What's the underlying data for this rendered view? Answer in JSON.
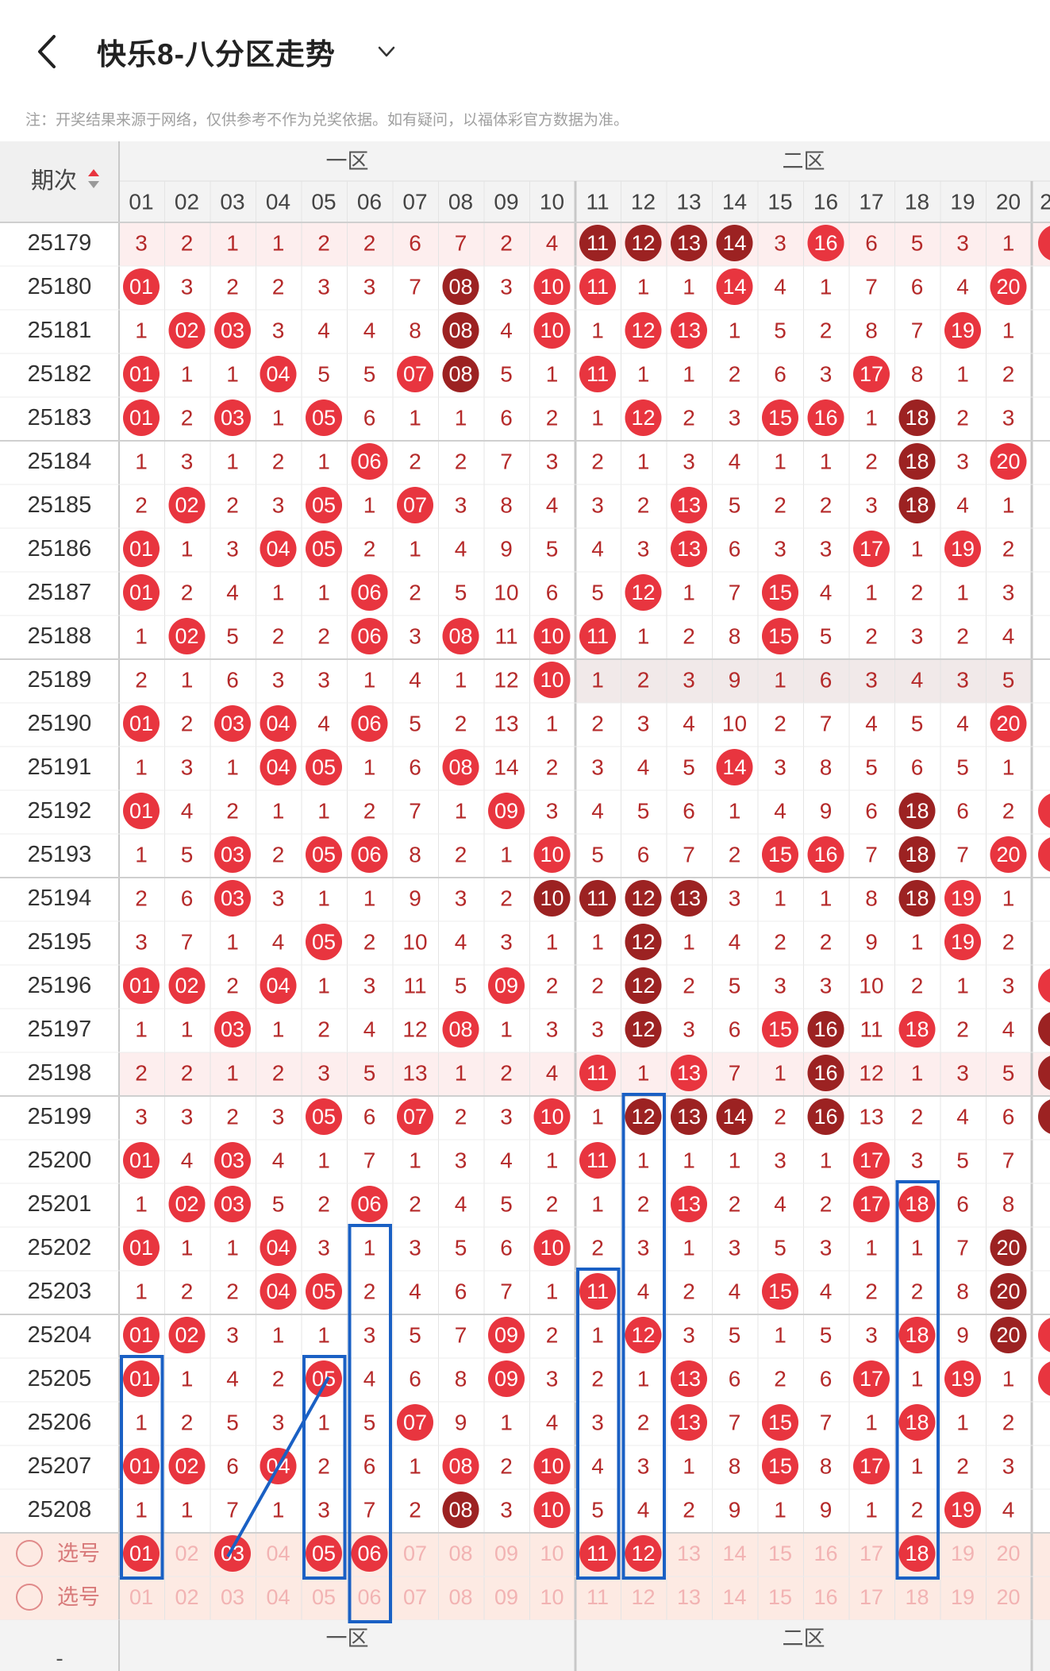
{
  "header": {
    "title": "快乐8-八分区走势",
    "back_icon": "chevron-left-icon",
    "dropdown_icon": "chevron-down-icon"
  },
  "note": "注：开奖结果来源于网络，仅供参考不作为兑奖依据。如有疑问，以福体彩官方数据为准。",
  "table": {
    "period_header": "期次",
    "sort_icon": "sort-arrows-icon",
    "zones": [
      "一区",
      "二区"
    ],
    "columns": [
      "01",
      "02",
      "03",
      "04",
      "05",
      "06",
      "07",
      "08",
      "09",
      "10",
      "11",
      "12",
      "13",
      "14",
      "15",
      "16",
      "17",
      "18",
      "19",
      "20"
    ],
    "rows": [
      {
        "period": "25179",
        "cells": [
          "3",
          "2",
          "1",
          "1",
          "2",
          "2",
          "6",
          "7",
          "2",
          "4",
          "11",
          "12",
          "13",
          "14",
          "3",
          "16",
          "6",
          "5",
          "3",
          "1"
        ],
        "dark": [
          "11",
          "12",
          "13",
          "14"
        ],
        "bg": "pink"
      },
      {
        "period": "25180",
        "cells": [
          "01",
          "3",
          "2",
          "2",
          "3",
          "3",
          "7",
          "08",
          "3",
          "10",
          "11",
          "1",
          "1",
          "14",
          "4",
          "1",
          "7",
          "6",
          "4",
          "20"
        ],
        "dark": [
          "08"
        ]
      },
      {
        "period": "25181",
        "cells": [
          "1",
          "02",
          "03",
          "3",
          "4",
          "4",
          "8",
          "08",
          "4",
          "10",
          "1",
          "12",
          "13",
          "1",
          "5",
          "2",
          "8",
          "7",
          "19",
          "1"
        ],
        "dark": [
          "08"
        ]
      },
      {
        "period": "25182",
        "cells": [
          "01",
          "1",
          "1",
          "04",
          "5",
          "5",
          "07",
          "08",
          "5",
          "1",
          "11",
          "1",
          "1",
          "2",
          "6",
          "3",
          "17",
          "8",
          "1",
          "2"
        ],
        "dark": [
          "08"
        ]
      },
      {
        "period": "25183",
        "cells": [
          "01",
          "2",
          "03",
          "1",
          "05",
          "6",
          "1",
          "1",
          "6",
          "2",
          "1",
          "12",
          "2",
          "3",
          "15",
          "16",
          "1",
          "18",
          "2",
          "3"
        ],
        "dark": [
          "18"
        ]
      },
      {
        "period": "25184",
        "cells": [
          "1",
          "3",
          "1",
          "2",
          "1",
          "06",
          "2",
          "2",
          "7",
          "3",
          "2",
          "1",
          "3",
          "4",
          "1",
          "1",
          "2",
          "18",
          "3",
          "20"
        ],
        "dark": [
          "18"
        ]
      },
      {
        "period": "25185",
        "cells": [
          "2",
          "02",
          "2",
          "3",
          "05",
          "1",
          "07",
          "3",
          "8",
          "4",
          "3",
          "2",
          "13",
          "5",
          "2",
          "2",
          "3",
          "18",
          "4",
          "1"
        ],
        "dark": [
          "18"
        ]
      },
      {
        "period": "25186",
        "cells": [
          "01",
          "1",
          "3",
          "04",
          "05",
          "2",
          "1",
          "4",
          "9",
          "5",
          "4",
          "3",
          "13",
          "6",
          "3",
          "3",
          "17",
          "1",
          "19",
          "2"
        ],
        "dark": []
      },
      {
        "period": "25187",
        "cells": [
          "01",
          "2",
          "4",
          "1",
          "1",
          "06",
          "2",
          "5",
          "10",
          "6",
          "5",
          "12",
          "1",
          "7",
          "15",
          "4",
          "1",
          "2",
          "1",
          "3"
        ],
        "dark": []
      },
      {
        "period": "25188",
        "cells": [
          "1",
          "02",
          "5",
          "2",
          "2",
          "06",
          "3",
          "08",
          "11",
          "10",
          "11",
          "1",
          "2",
          "8",
          "15",
          "5",
          "2",
          "3",
          "2",
          "4"
        ],
        "dark": []
      },
      {
        "period": "25189",
        "cells": [
          "2",
          "1",
          "6",
          "3",
          "3",
          "1",
          "4",
          "1",
          "12",
          "10",
          "1",
          "2",
          "3",
          "9",
          "1",
          "6",
          "3",
          "4",
          "3",
          "5"
        ],
        "dark": [],
        "bg": "zone2-gray"
      },
      {
        "period": "25190",
        "cells": [
          "01",
          "2",
          "03",
          "04",
          "4",
          "06",
          "5",
          "2",
          "13",
          "1",
          "2",
          "3",
          "4",
          "10",
          "2",
          "7",
          "4",
          "5",
          "4",
          "20"
        ],
        "dark": []
      },
      {
        "period": "25191",
        "cells": [
          "1",
          "3",
          "1",
          "04",
          "05",
          "1",
          "6",
          "08",
          "14",
          "2",
          "3",
          "4",
          "5",
          "14",
          "3",
          "8",
          "5",
          "6",
          "5",
          "1"
        ],
        "dark": []
      },
      {
        "period": "25192",
        "cells": [
          "01",
          "4",
          "2",
          "1",
          "1",
          "2",
          "7",
          "1",
          "09",
          "3",
          "4",
          "5",
          "6",
          "1",
          "4",
          "9",
          "6",
          "18",
          "6",
          "2"
        ],
        "dark": [
          "18"
        ]
      },
      {
        "period": "25193",
        "cells": [
          "1",
          "5",
          "03",
          "2",
          "05",
          "06",
          "8",
          "2",
          "1",
          "10",
          "5",
          "6",
          "7",
          "2",
          "15",
          "16",
          "7",
          "18",
          "7",
          "20"
        ],
        "dark": [
          "18"
        ]
      },
      {
        "period": "25194",
        "cells": [
          "2",
          "6",
          "03",
          "3",
          "1",
          "1",
          "9",
          "3",
          "2",
          "10",
          "11",
          "12",
          "13",
          "3",
          "1",
          "1",
          "8",
          "18",
          "19",
          "1"
        ],
        "dark": [
          "10",
          "11",
          "12",
          "13",
          "18"
        ]
      },
      {
        "period": "25195",
        "cells": [
          "3",
          "7",
          "1",
          "4",
          "05",
          "2",
          "10",
          "4",
          "3",
          "1",
          "1",
          "12",
          "1",
          "4",
          "2",
          "2",
          "9",
          "1",
          "19",
          "2"
        ],
        "dark": [
          "12"
        ]
      },
      {
        "period": "25196",
        "cells": [
          "01",
          "02",
          "2",
          "04",
          "1",
          "3",
          "11",
          "5",
          "09",
          "2",
          "2",
          "12",
          "2",
          "5",
          "3",
          "3",
          "10",
          "2",
          "1",
          "3"
        ],
        "dark": [
          "12"
        ]
      },
      {
        "period": "25197",
        "cells": [
          "1",
          "1",
          "03",
          "1",
          "2",
          "4",
          "12",
          "08",
          "1",
          "3",
          "3",
          "12",
          "3",
          "6",
          "15",
          "16",
          "11",
          "18",
          "2",
          "4"
        ],
        "dark": [
          "12",
          "16"
        ]
      },
      {
        "period": "25198",
        "cells": [
          "2",
          "2",
          "1",
          "2",
          "3",
          "5",
          "13",
          "1",
          "2",
          "4",
          "11",
          "1",
          "13",
          "7",
          "1",
          "16",
          "12",
          "1",
          "3",
          "5"
        ],
        "dark": [
          "16"
        ],
        "bg": "pink"
      },
      {
        "period": "25199",
        "cells": [
          "3",
          "3",
          "2",
          "3",
          "05",
          "6",
          "07",
          "2",
          "3",
          "10",
          "1",
          "12",
          "13",
          "14",
          "2",
          "16",
          "13",
          "2",
          "4",
          "6"
        ],
        "dark": [
          "12",
          "13",
          "14",
          "16"
        ]
      },
      {
        "period": "25200",
        "cells": [
          "01",
          "4",
          "03",
          "4",
          "1",
          "7",
          "1",
          "3",
          "4",
          "1",
          "11",
          "1",
          "1",
          "1",
          "3",
          "1",
          "17",
          "3",
          "5",
          "7"
        ],
        "dark": []
      },
      {
        "period": "25201",
        "cells": [
          "1",
          "02",
          "03",
          "5",
          "2",
          "06",
          "2",
          "4",
          "5",
          "2",
          "1",
          "2",
          "13",
          "2",
          "4",
          "2",
          "17",
          "18",
          "6",
          "8"
        ],
        "dark": []
      },
      {
        "period": "25202",
        "cells": [
          "01",
          "1",
          "1",
          "04",
          "3",
          "1",
          "3",
          "5",
          "6",
          "10",
          "2",
          "3",
          "1",
          "3",
          "5",
          "3",
          "1",
          "1",
          "7",
          "20"
        ],
        "dark": [
          "20"
        ]
      },
      {
        "period": "25203",
        "cells": [
          "1",
          "2",
          "2",
          "04",
          "05",
          "2",
          "4",
          "6",
          "7",
          "1",
          "11",
          "4",
          "2",
          "4",
          "15",
          "4",
          "2",
          "2",
          "8",
          "20"
        ],
        "dark": [
          "20"
        ]
      },
      {
        "period": "25204",
        "cells": [
          "01",
          "02",
          "3",
          "1",
          "1",
          "3",
          "5",
          "7",
          "09",
          "2",
          "1",
          "12",
          "3",
          "5",
          "1",
          "5",
          "3",
          "18",
          "9",
          "20"
        ],
        "dark": [
          "20"
        ]
      },
      {
        "period": "25205",
        "cells": [
          "01",
          "1",
          "4",
          "2",
          "05",
          "4",
          "6",
          "8",
          "09",
          "3",
          "2",
          "1",
          "13",
          "6",
          "2",
          "6",
          "17",
          "1",
          "19",
          "1"
        ],
        "dark": []
      },
      {
        "period": "25206",
        "cells": [
          "1",
          "2",
          "5",
          "3",
          "1",
          "5",
          "07",
          "9",
          "1",
          "4",
          "3",
          "2",
          "13",
          "7",
          "15",
          "7",
          "1",
          "18",
          "1",
          "2"
        ],
        "dark": []
      },
      {
        "period": "25207",
        "cells": [
          "01",
          "02",
          "6",
          "04",
          "2",
          "6",
          "1",
          "08",
          "2",
          "10",
          "4",
          "3",
          "1",
          "8",
          "15",
          "8",
          "17",
          "1",
          "2",
          "3"
        ],
        "dark": []
      },
      {
        "period": "25208",
        "cells": [
          "1",
          "1",
          "7",
          "1",
          "3",
          "7",
          "2",
          "08",
          "3",
          "10",
          "5",
          "4",
          "2",
          "9",
          "1",
          "9",
          "1",
          "2",
          "19",
          "4"
        ],
        "dark": [
          "08"
        ]
      }
    ],
    "select_label": "选号",
    "select_rows": [
      {
        "selected": [
          "01",
          "03",
          "05",
          "06",
          "11",
          "12",
          "18"
        ]
      },
      {
        "selected": []
      }
    ],
    "footer_period": "-",
    "col21_dark_rows": [
      "25197",
      "25198",
      "25199"
    ]
  },
  "colors": {
    "ball_red": "#e8353f",
    "ball_dark": "#9c2222",
    "miss_text": "#b52a2a",
    "row_pink": "#fdeeee",
    "select_bg": "#fdeae3",
    "frame_blue": "#1a60c4"
  }
}
